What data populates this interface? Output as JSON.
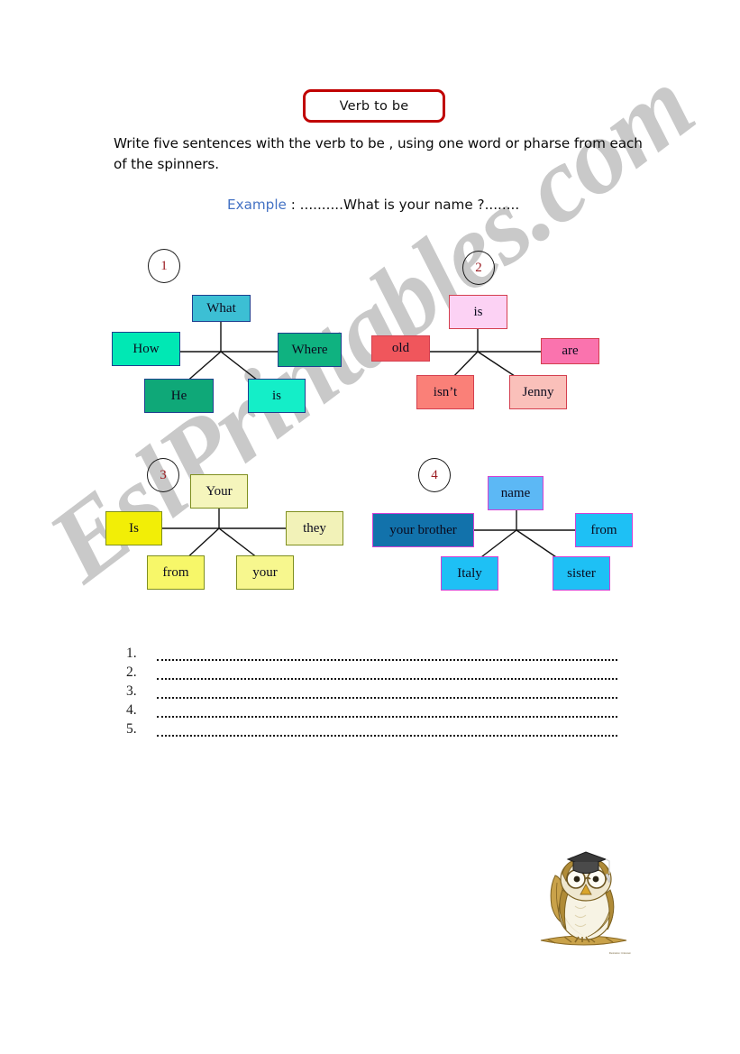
{
  "title": "Verb to be",
  "instructions": "Write five sentences with the verb to be , using one word or pharse from each of the spinners.",
  "example": {
    "label": "Example",
    "text": " : ..........What is your name ?........"
  },
  "watermark": "EslPrintables.com",
  "colors": {
    "title_border": "#c00000",
    "example_label": "#4472c4",
    "number_circle_text": "#9b1c22",
    "spinner1_border": "#1f3f8f",
    "spinner2_border": "#d43f4f",
    "spinner3_border": "#7f8f1f",
    "spinner4_border": "#d43fd4"
  },
  "spinners": [
    {
      "number": "1",
      "border": "#1f3f8f",
      "items": [
        {
          "label": "What",
          "fill": "#3cbfd4"
        },
        {
          "label": "How",
          "fill": "#00e8b4"
        },
        {
          "label": "Where",
          "fill": "#0fb280"
        },
        {
          "label": "He",
          "fill": "#0fa878"
        },
        {
          "label": "is",
          "fill": "#14eec8"
        }
      ]
    },
    {
      "number": "2",
      "border": "#d43f4f",
      "items": [
        {
          "label": "is",
          "fill": "#fcd2f4"
        },
        {
          "label": "old",
          "fill": "#f0565c"
        },
        {
          "label": "are",
          "fill": "#fa73ae"
        },
        {
          "label": "isn’t",
          "fill": "#fa8078"
        },
        {
          "label": "Jenny",
          "fill": "#fac0ba"
        }
      ]
    },
    {
      "number": "3",
      "border": "#7f8f1f",
      "items": [
        {
          "label": "Your",
          "fill": "#f5f5bc"
        },
        {
          "label": "Is",
          "fill": "#f2ee06"
        },
        {
          "label": "they",
          "fill": "#f2f2b8"
        },
        {
          "label": "from",
          "fill": "#f7f769"
        },
        {
          "label": "your",
          "fill": "#f7f78e"
        }
      ]
    },
    {
      "number": "4",
      "border": "#d43fd4",
      "items": [
        {
          "label": "name",
          "fill": "#5cb8f5"
        },
        {
          "label": "your brother",
          "fill": "#1272ab"
        },
        {
          "label": "from",
          "fill": "#1ec0f5"
        },
        {
          "label": "Italy",
          "fill": "#1ec0f5"
        },
        {
          "label": "sister",
          "fill": "#1ec0f5"
        }
      ]
    }
  ],
  "answer_lines": [
    "1.",
    "2.",
    "3.",
    "4.",
    "5."
  ],
  "owl": {
    "alt": "owl-with-graduation-cap-clipart",
    "credit": "Illustration: Unknown"
  }
}
